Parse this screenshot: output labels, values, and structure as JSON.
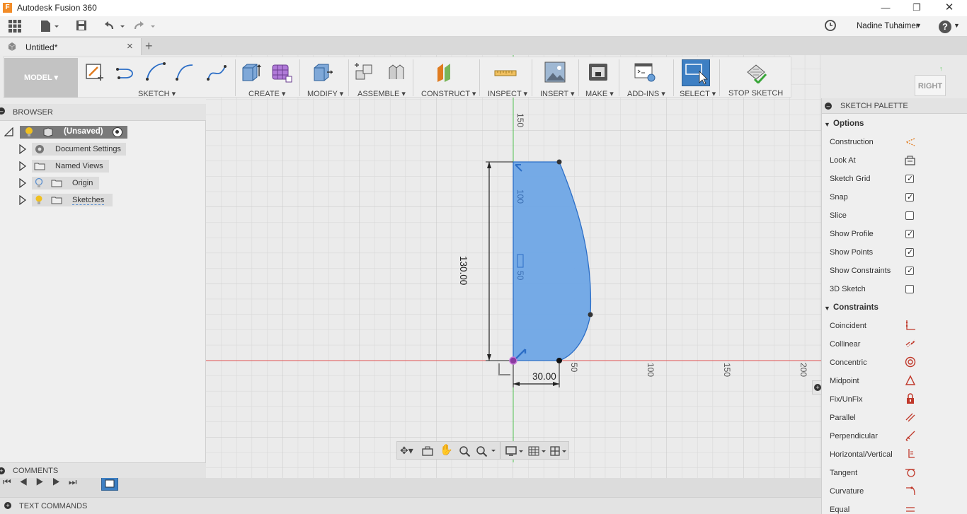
{
  "window": {
    "title": "Autodesk Fusion 360",
    "app_letter": "F"
  },
  "app_toolbar": {
    "user_name": "Nadine Tuhaimer",
    "help": "?"
  },
  "tab": {
    "label": "Untitled*",
    "close": "×",
    "add": "+"
  },
  "ribbon": {
    "mode": "MODEL",
    "groups": {
      "sketch": "SKETCH",
      "create": "CREATE",
      "modify": "MODIFY",
      "assemble": "ASSEMBLE",
      "construct": "CONSTRUCT",
      "inspect": "INSPECT",
      "insert": "INSERT",
      "make": "MAKE",
      "addins": "ADD-INS",
      "select": "SELECT",
      "stop_sketch": "STOP SKETCH"
    }
  },
  "browser": {
    "title": "BROWSER",
    "root": "(Unsaved)",
    "items": [
      {
        "label": "Document Settings"
      },
      {
        "label": "Named Views"
      },
      {
        "label": "Origin"
      },
      {
        "label": "Sketches"
      }
    ]
  },
  "viewcube": {
    "face": "RIGHT"
  },
  "sketch": {
    "dim_height": "130.00",
    "dim_width": "30.00",
    "axis_labels_y": [
      "150",
      "100",
      "50"
    ],
    "axis_labels_x": [
      "50",
      "100",
      "150",
      "200"
    ]
  },
  "palette": {
    "title": "SKETCH PALETTE",
    "options_title": "Options",
    "options": [
      {
        "label": "Construction",
        "icon": "construction-icon"
      },
      {
        "label": "Look At",
        "icon": "look-at-icon"
      },
      {
        "label": "Sketch Grid",
        "checked": true
      },
      {
        "label": "Snap",
        "checked": true
      },
      {
        "label": "Slice",
        "checked": false
      },
      {
        "label": "Show Profile",
        "checked": true
      },
      {
        "label": "Show Points",
        "checked": true
      },
      {
        "label": "Show Constraints",
        "checked": true
      },
      {
        "label": "3D Sketch",
        "checked": false
      }
    ],
    "constraints_title": "Constraints",
    "constraints": [
      {
        "label": "Coincident",
        "icon": "coincident-icon"
      },
      {
        "label": "Collinear",
        "icon": "collinear-icon"
      },
      {
        "label": "Concentric",
        "icon": "concentric-icon"
      },
      {
        "label": "Midpoint",
        "icon": "midpoint-icon"
      },
      {
        "label": "Fix/UnFix",
        "icon": "lock-icon"
      },
      {
        "label": "Parallel",
        "icon": "parallel-icon"
      },
      {
        "label": "Perpendicular",
        "icon": "perpendicular-icon"
      },
      {
        "label": "Horizontal/Vertical",
        "icon": "horizontal-vertical-icon"
      },
      {
        "label": "Tangent",
        "icon": "tangent-icon"
      },
      {
        "label": "Curvature",
        "icon": "curvature-icon"
      },
      {
        "label": "Equal",
        "icon": "equal-icon"
      }
    ]
  },
  "bottom": {
    "comments": "COMMENTS",
    "text_commands": "TEXT COMMANDS"
  },
  "colors": {
    "accent_orange": "#e07b1f",
    "profile_fill": "#6fa6e6",
    "profile_stroke": "#2d6fc7",
    "select_blue": "#3d7fc3",
    "x_axis": "#e05252",
    "y_axis": "#52c052"
  }
}
